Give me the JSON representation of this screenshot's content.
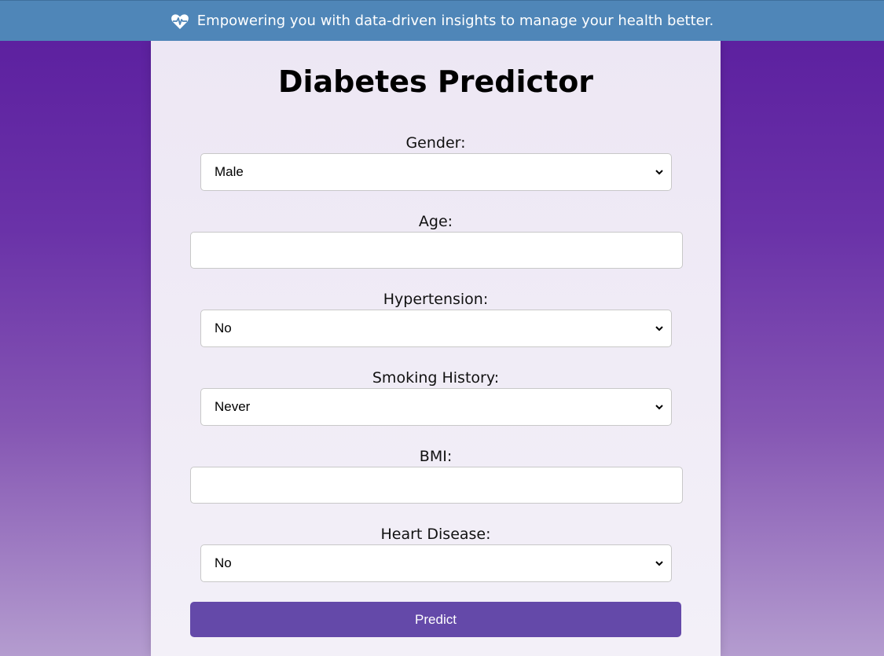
{
  "banner": {
    "icon": "heart-pulse-icon",
    "text": "Empowering you with data-driven insights to manage your health better."
  },
  "form": {
    "title": "Diabetes Predictor",
    "fields": {
      "gender": {
        "label": "Gender:",
        "value": "Male"
      },
      "age": {
        "label": "Age:",
        "value": ""
      },
      "hypertension": {
        "label": "Hypertension:",
        "value": "No"
      },
      "smoking_history": {
        "label": "Smoking History:",
        "value": "Never"
      },
      "bmi": {
        "label": "BMI:",
        "value": ""
      },
      "heart_disease": {
        "label": "Heart Disease:",
        "value": "No"
      }
    },
    "submit_label": "Predict"
  },
  "colors": {
    "banner": "#4f86b8",
    "accent": "#6449a9",
    "background_top": "#5a1d9e",
    "background_bottom": "#b49ccf"
  }
}
